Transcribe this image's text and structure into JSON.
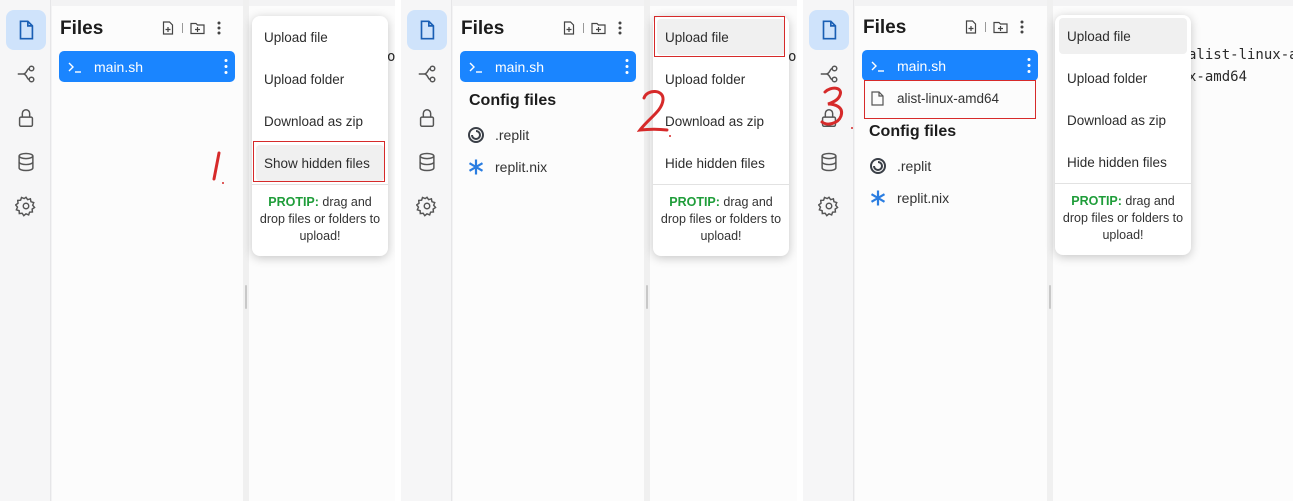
{
  "accent_color": "#1a85ff",
  "annotation_color": "#d62a2a",
  "steps": [
    {
      "pane": {
        "title": "Files",
        "main_file": "main.sh"
      },
      "menu": {
        "items": [
          "Upload file",
          "Upload folder",
          "Download as zip",
          "Show hidden files"
        ],
        "protip_label": "PROTIP:",
        "protip_text": " drag and drop files or folders to upload!"
      },
      "editor_lines": [
        "o"
      ],
      "annotation": "1"
    },
    {
      "pane": {
        "title": "Files",
        "main_file": "main.sh",
        "config_title": "Config files",
        "config_items": [
          ".replit",
          "replit.nix"
        ]
      },
      "menu": {
        "items": [
          "Upload file",
          "Upload folder",
          "Download as zip",
          "Hide hidden files"
        ],
        "protip_label": "PROTIP:",
        "protip_text": " drag and drop files or folders to upload!"
      },
      "editor_lines": [
        "o"
      ],
      "annotation": "2"
    },
    {
      "pane": {
        "title": "Files",
        "main_file": "main.sh",
        "uploaded_file": "alist-linux-amd64",
        "config_title": "Config files",
        "config_items": [
          ".replit",
          "replit.nix"
        ]
      },
      "menu": {
        "items": [
          "Upload file",
          "Upload folder",
          "Download as zip",
          "Hide hidden files"
        ],
        "protip_label": "PROTIP:",
        "protip_text": " drag and drop files or folders to upload!"
      },
      "editor_lines": [
        "alist-linux-am",
        "x-amd64"
      ],
      "annotation": "3"
    }
  ]
}
